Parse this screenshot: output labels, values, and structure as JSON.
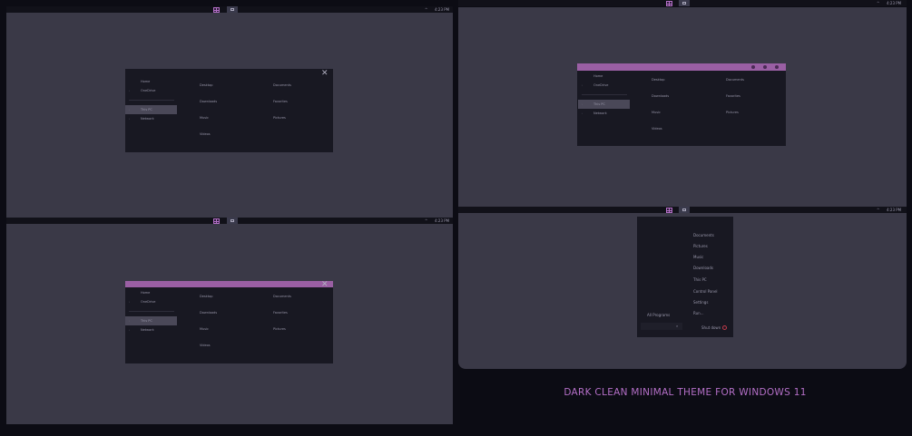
{
  "taskbar": {
    "clock": "4:23 PM",
    "tray_chevron": "^"
  },
  "explorer": {
    "close_glyph": "✕",
    "nav": [
      "Home",
      "OneDrive",
      "This PC",
      "Network"
    ],
    "folders": [
      "Desktop",
      "Documents",
      "Downloads",
      "Favorites",
      "Music",
      "Pictures",
      "Videos"
    ]
  },
  "start_menu": {
    "items": [
      "Documents",
      "Pictures",
      "Music",
      "Downloads",
      "This PC",
      "Control Panel",
      "Settings",
      "Run..."
    ],
    "all_programs": "All Programs",
    "shut_down": "Shut down"
  },
  "headline": "DARK CLEAN MINIMAL THEME FOR WINDOWS 11",
  "colors": {
    "accent": "#b46fc7",
    "titlebar": "#9a5fa4",
    "window_bg": "#181822",
    "desktop_bg": "#3a3947"
  }
}
